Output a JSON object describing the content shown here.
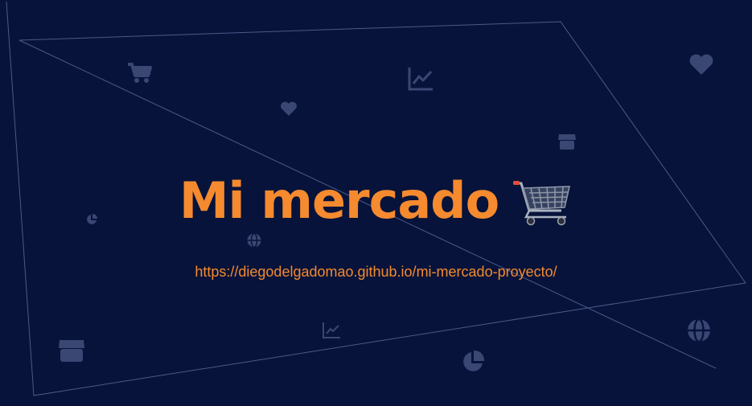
{
  "page": {
    "title": "Mi mercado",
    "url": "https://diegodelgadomao.github.io/mi-mercado-proyecto/"
  },
  "colors": {
    "background": "#07133a",
    "accent": "#f58a2f",
    "line": "#4a5a8a",
    "icon": "#3a4773"
  },
  "icons": {
    "title_emoji": "shopping-cart-icon",
    "decorative": [
      "cart-icon",
      "chart-line-icon",
      "heart-icon",
      "store-icon",
      "pie-chart-icon",
      "globe-icon"
    ]
  }
}
